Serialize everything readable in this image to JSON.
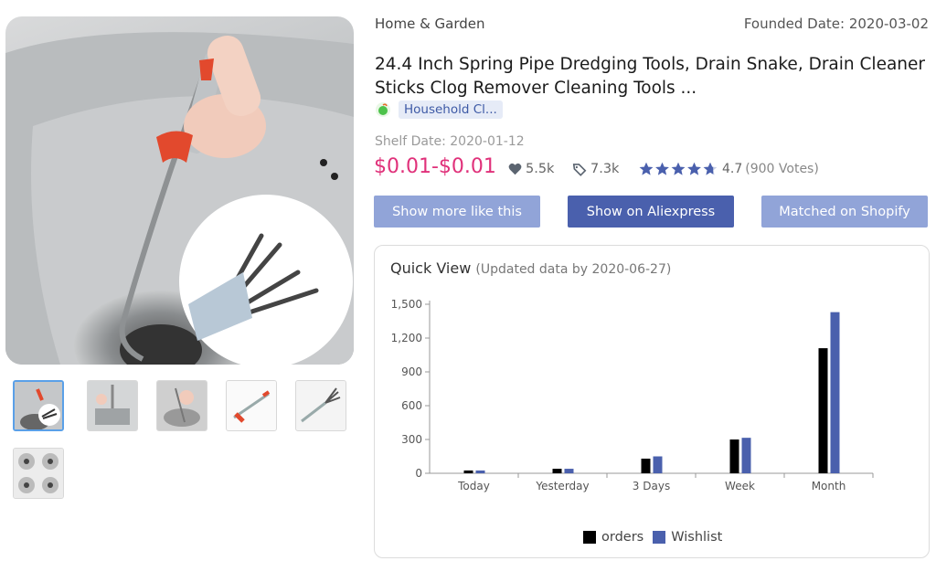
{
  "product": {
    "category": "Home & Garden",
    "founded_label": "Founded Date: 2020-03-02",
    "title": "24.4 Inch Spring Pipe Dredging Tools, Drain Snake, Drain Cleaner Sticks Clog Remover Cleaning Tools ...",
    "tag": "Household Cl...",
    "shelf_date": "Shelf Date: 2020-01-12",
    "price": "$0.01-$0.01",
    "likes": "5.5k",
    "tags_count": "7.3k",
    "rating": "4.7",
    "votes": "(900 Votes)",
    "stars_value": 4.7
  },
  "buttons": {
    "more": "Show more like this",
    "aliexpress": "Show on Aliexpress",
    "shopify": "Matched on Shopify"
  },
  "quick_view": {
    "title": "Quick View",
    "subtitle": "(Updated data by 2020-06-27)"
  },
  "colors": {
    "accent": "#4a60ad",
    "button_light": "#91a4d8",
    "price": "#e0317a",
    "orders": "#000000",
    "wishlist": "#4a60ad"
  },
  "chart_data": {
    "type": "bar",
    "categories": [
      "Today",
      "Yesterday",
      "3 Days",
      "Week",
      "Month"
    ],
    "series": [
      {
        "name": "orders",
        "values": [
          25,
          40,
          130,
          300,
          1110
        ]
      },
      {
        "name": "Wishlist",
        "values": [
          25,
          40,
          150,
          315,
          1430
        ]
      }
    ],
    "yticks": [
      "0",
      "300",
      "600",
      "900",
      "1,200",
      "1,500"
    ],
    "ylim": [
      0,
      1500
    ],
    "legend": "bottom"
  }
}
